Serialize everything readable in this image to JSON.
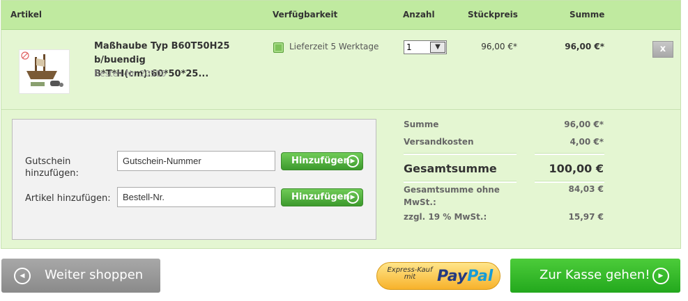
{
  "header": {
    "col_article": "Artikel",
    "col_availability": "Verfügbarkeit",
    "col_quantity": "Anzahl",
    "col_unit_price": "Stückpreis",
    "col_sum": "Summe"
  },
  "item": {
    "name": "Maßhaube Typ B60T50H25 b/buendig B*T*H(cm):60*50*25...",
    "order_number": "Bestell-Nr. 20500",
    "availability": "Lieferzeit 5 Werktage",
    "quantity": "1",
    "unit_price": "96,00 €*",
    "sum": "96,00 €*",
    "delete_label": "x"
  },
  "voucher": {
    "coupon_label": "Gutschein hinzufügen:",
    "coupon_placeholder": "Gutschein-Nummer",
    "coupon_button": "Hinzufügen",
    "article_label": "Artikel hinzufügen:",
    "article_placeholder": "Bestell-Nr.",
    "article_button": "Hinzufügen"
  },
  "totals": {
    "subtotal_label": "Summe",
    "subtotal_value": "96,00 €*",
    "shipping_label": "Versandkosten",
    "shipping_value": "4,00 €*",
    "grand_label": "Gesamtsumme",
    "grand_value": "100,00 €",
    "net_label": "Gesamtsumme ohne MwSt.:",
    "net_value": "84,03 €",
    "tax_label": "zzgl. 19 % MwSt.:",
    "tax_value": "15,97 €"
  },
  "actions": {
    "continue_label": "Weiter shoppen",
    "paypal_express": "Express-Kauf mit",
    "paypal_brand": "PayPal",
    "checkout_label": "Zur Kasse gehen!"
  },
  "colors": {
    "header_bg": "#c0eaa0",
    "cart_bg": "#e4f6d2",
    "accent_green": "#3d9a2d",
    "paypal_blue": "#253b80",
    "paypal_cyan": "#179bd7"
  }
}
